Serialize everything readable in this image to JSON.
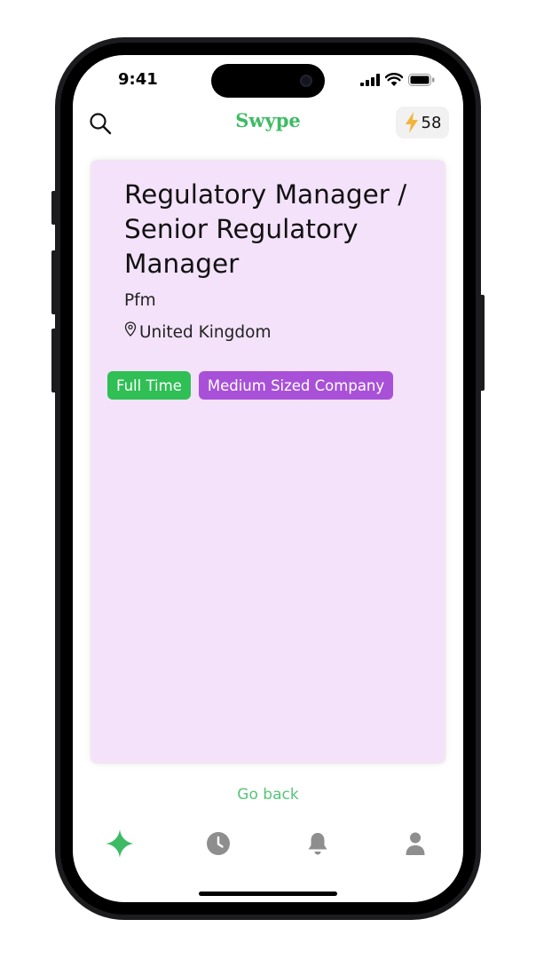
{
  "status_bar": {
    "time": "9:41"
  },
  "header": {
    "logo_text": "Swype",
    "credits_count": "58",
    "search_icon": "search-icon",
    "credits_icon": "lightning-bolt-icon"
  },
  "job_card": {
    "title": "Regulatory Manager / Senior Regulatory Manager",
    "company": "Pfm",
    "location": "United Kingdom",
    "tags": [
      {
        "label": "Full Time",
        "color": "#2fbf55"
      },
      {
        "label": "Medium Sized Company",
        "color": "#a851d8"
      }
    ],
    "background": "#f4e2fa"
  },
  "go_back_label": "Go back",
  "bottom_nav": [
    {
      "icon": "sparkle-icon",
      "active": true
    },
    {
      "icon": "clock-icon",
      "active": false
    },
    {
      "icon": "bell-icon",
      "active": false
    },
    {
      "icon": "person-icon",
      "active": false
    }
  ],
  "colors": {
    "accent": "#3dbb64",
    "inactive_icon": "#8e8e8e"
  }
}
